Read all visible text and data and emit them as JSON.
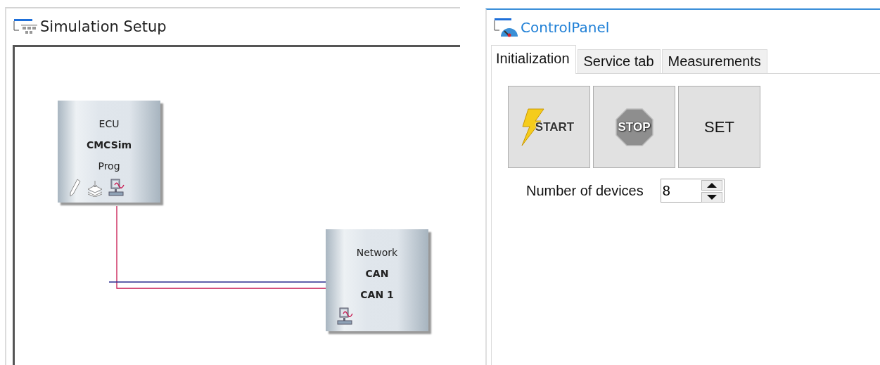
{
  "simulation_setup": {
    "title": "Simulation Setup",
    "nodes": [
      {
        "kind": "ecu",
        "lines": [
          "ECU",
          "CMCSim",
          "Prog"
        ]
      },
      {
        "kind": "network",
        "lines": [
          "Network",
          "CAN",
          "CAN 1"
        ]
      }
    ]
  },
  "control_panel": {
    "title": "ControlPanel",
    "tabs": [
      {
        "label": "Initialization",
        "selected": true
      },
      {
        "label": "Service tab",
        "selected": false
      },
      {
        "label": "Measurements",
        "selected": false
      }
    ],
    "buttons": [
      {
        "kind": "start",
        "label": "START"
      },
      {
        "kind": "stop",
        "label": "STOP"
      },
      {
        "kind": "set",
        "label": "SET"
      }
    ],
    "number_of_devices": {
      "label": "Number of devices",
      "value": "8"
    }
  }
}
